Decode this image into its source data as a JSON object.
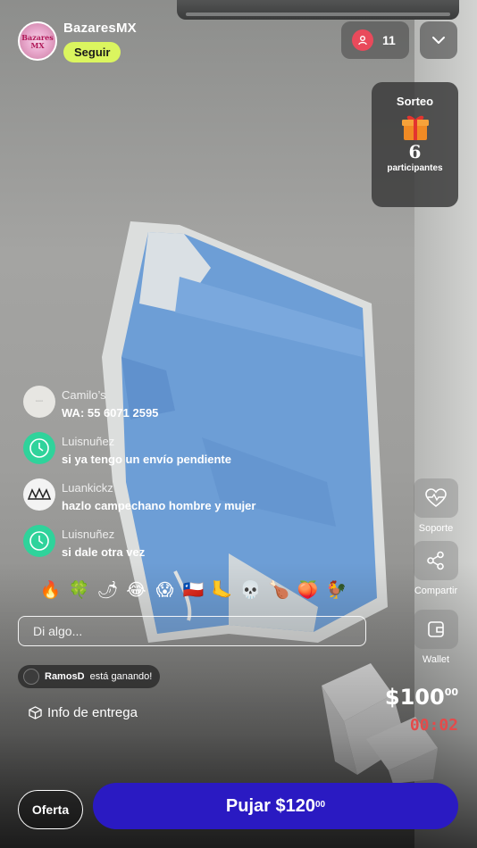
{
  "header": {
    "store_name": "BazaresMX",
    "follow_label": "Seguir",
    "viewer_count": "11",
    "avatar_text": "Bazares MX"
  },
  "giveaway": {
    "title": "Sorteo",
    "count": "6",
    "label": "participantes"
  },
  "chat": {
    "messages": [
      {
        "user": "Camilo’s",
        "text": "WA: 55 6071 2595"
      },
      {
        "user": "Luisnuñez",
        "text": "si ya tengo un envío pendiente"
      },
      {
        "user": "Luankickz",
        "text": "hazlo campechano hombre y mujer"
      },
      {
        "user": "Luisnuñez",
        "text": "si dale otra vez"
      }
    ],
    "emojis": [
      "🔥",
      "🍀",
      "🌶",
      "😂",
      "😱",
      "🇨🇱",
      "🦶",
      "💀",
      "🍗",
      "🍑",
      "🐓"
    ],
    "input_placeholder": "Di algo..."
  },
  "auction": {
    "leader_user": "RamosD",
    "leader_suffix": "está ganando!",
    "current_price": "$100",
    "current_price_cents": "00",
    "timer": "00:02",
    "delivery_info": "Info de entrega"
  },
  "side_actions": [
    {
      "label": "Soporte",
      "icon": "heart-pulse-icon"
    },
    {
      "label": "Compartir",
      "icon": "share-icon"
    },
    {
      "label": "Wallet",
      "icon": "wallet-icon"
    }
  ],
  "bottom": {
    "offer_label": "Oferta",
    "bid_label": "Pujar $120",
    "bid_cents": "00"
  },
  "colors": {
    "follow_bg": "#dbf55f",
    "bid_bg": "#2a1ac2",
    "timer": "#e34b4b",
    "viewer_icon_bg": "#e94a5b"
  }
}
